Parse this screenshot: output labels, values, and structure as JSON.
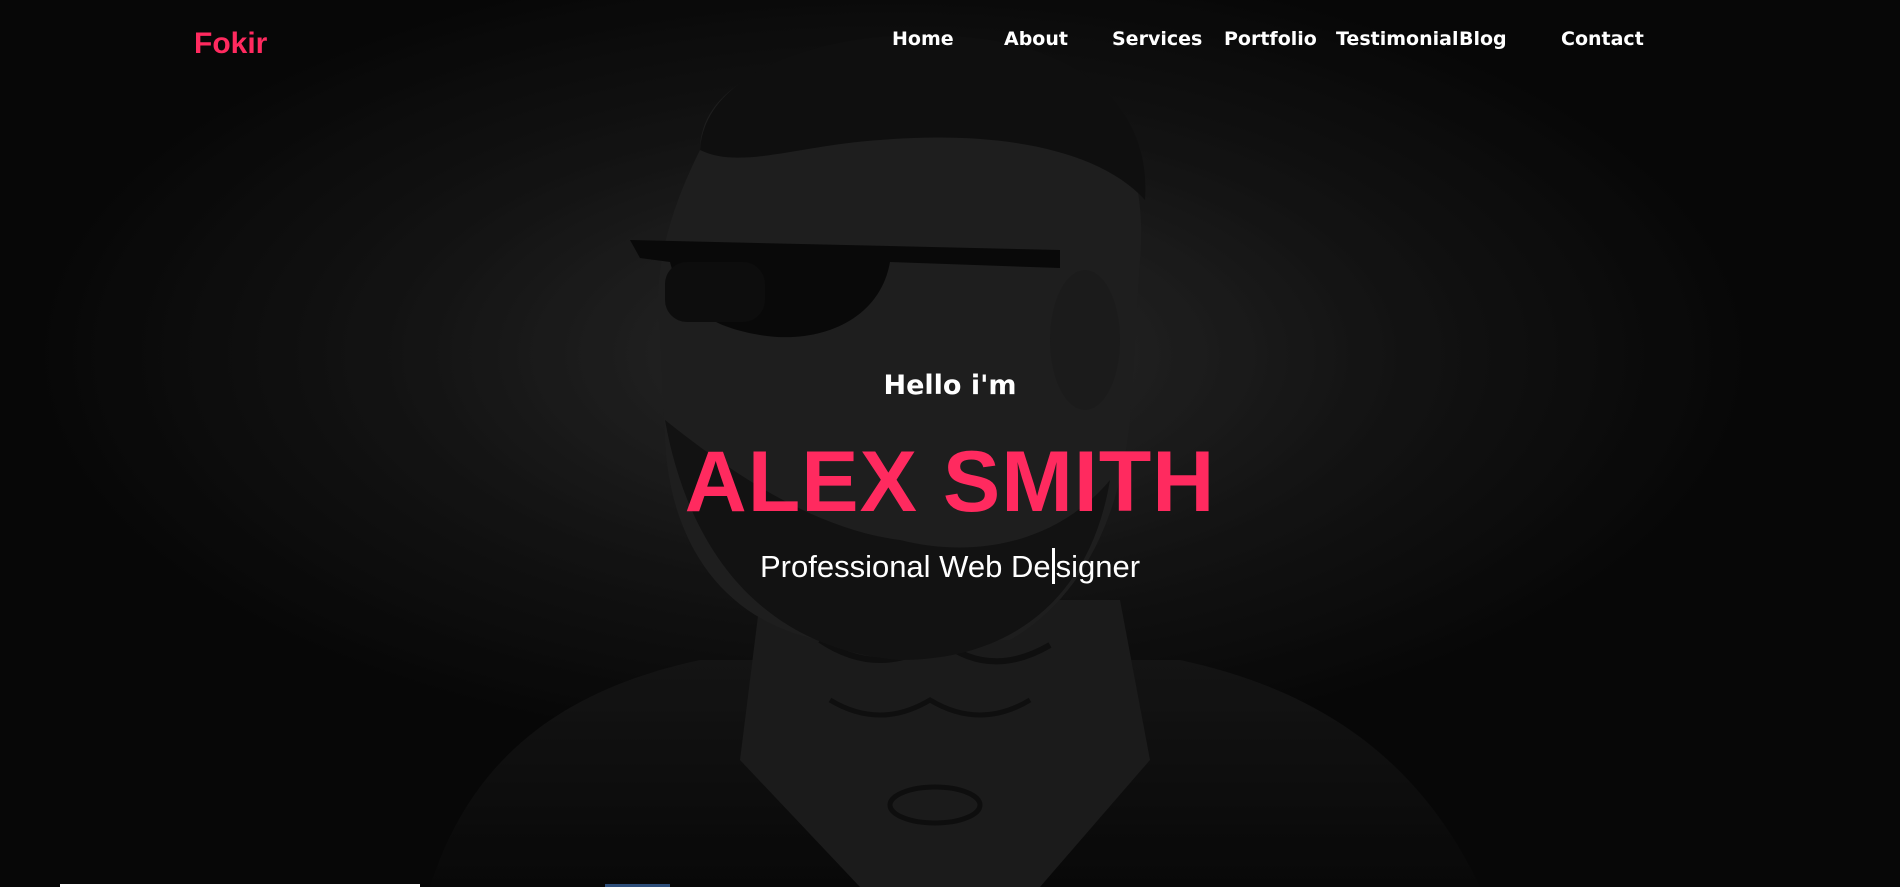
{
  "brand": {
    "name": "Fokir",
    "color": "#ff2a5f"
  },
  "nav": {
    "items": [
      {
        "label": "Home"
      },
      {
        "label": "About"
      },
      {
        "label": "Services"
      },
      {
        "label": "Portfolio"
      },
      {
        "label": "Testimonial"
      },
      {
        "label": "Blog"
      },
      {
        "label": "Contact"
      }
    ]
  },
  "hero": {
    "greeting": "Hello i'm",
    "name": "ALEX SMITH",
    "role_part1": "Professional Web De",
    "role_part2": "signer",
    "accent_color": "#ff2a5f"
  }
}
